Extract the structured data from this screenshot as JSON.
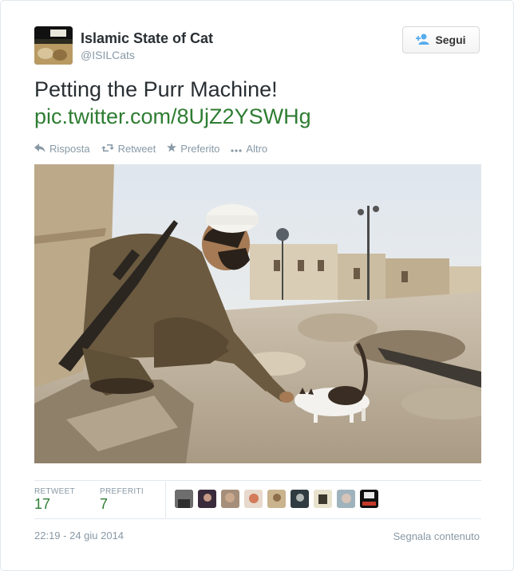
{
  "user": {
    "name": "Islamic State of Cat",
    "handle": "@ISILCats",
    "avatar_icon": "user-avatar"
  },
  "follow": {
    "label": "Segui",
    "icon": "user-plus-icon"
  },
  "tweet": {
    "text": "Petting the Purr Machine!",
    "link": "pic.twitter.com/8UjZ2YSWHg"
  },
  "actions": {
    "reply": "Risposta",
    "retweet": "Retweet",
    "favorite": "Preferito",
    "more": "Altro"
  },
  "stats": {
    "retweet_label": "RETWEET",
    "retweet_count": "17",
    "favorites_label": "PREFERITI",
    "favorites_count": "7"
  },
  "timestamp": "22:19 - 24 giu 2014",
  "report": "Segnala contenuto",
  "colors": {
    "link": "#2e7d32",
    "muted": "#8899a6",
    "text": "#292f33"
  }
}
